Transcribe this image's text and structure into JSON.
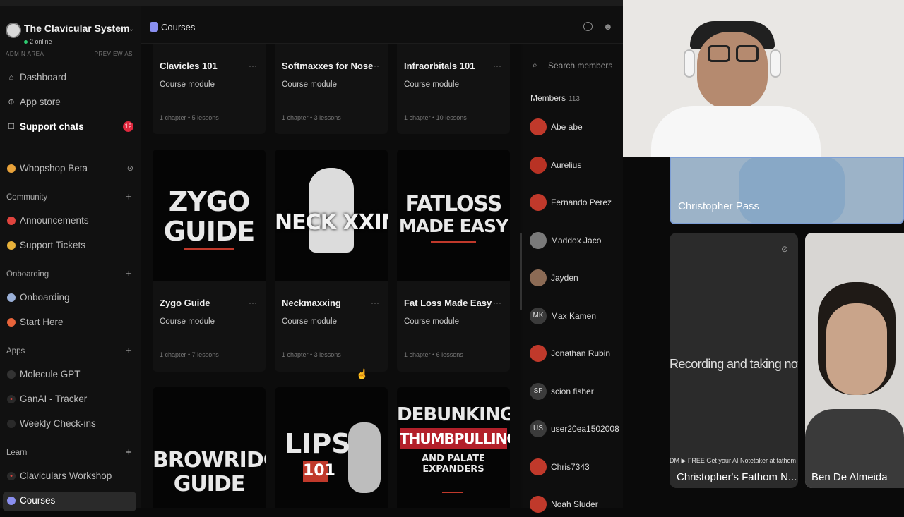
{
  "workspace": {
    "name": "The Clavicular System",
    "online": "2 online"
  },
  "admin": {
    "label": "ADMIN AREA",
    "preview": "PREVIEW AS"
  },
  "nav_top": [
    {
      "label": "Dashboard",
      "icon": "home-icon"
    },
    {
      "label": "App store",
      "icon": "plus-circle-icon"
    },
    {
      "label": "Support chats",
      "icon": "chat-icon",
      "badge": "12"
    }
  ],
  "whopshop": {
    "label": "Whopshop Beta"
  },
  "sections": {
    "community": {
      "label": "Community",
      "items": [
        "Announcements",
        "Support Tickets"
      ]
    },
    "onboarding": {
      "label": "Onboarding",
      "items": [
        "Onboarding",
        "Start Here"
      ]
    },
    "apps": {
      "label": "Apps",
      "items": [
        "Molecule GPT",
        "GanAI - Tracker",
        "Weekly Check-ins"
      ]
    },
    "learn": {
      "label": "Learn",
      "items": [
        "Claviculars Workshop",
        "Courses"
      ]
    }
  },
  "header": {
    "title": "Courses"
  },
  "courses": [
    {
      "title": "Clavicles 101",
      "type": "Course module",
      "meta": "1 chapter • 5 lessons"
    },
    {
      "title": "Softmaxxes for Nose",
      "type": "Course module",
      "meta": "1 chapter • 3 lessons"
    },
    {
      "title": "Infraorbitals 101",
      "type": "Course module",
      "meta": "1 chapter • 10 lessons"
    },
    {
      "title": "Zygo Guide",
      "type": "Course module",
      "meta": "1 chapter • 7 lessons",
      "art": [
        "ZYGO",
        "GUIDE"
      ]
    },
    {
      "title": "Neckmaxxing",
      "type": "Course module",
      "meta": "1 chapter • 3 lessons",
      "art": [
        "NECK",
        "XXING"
      ]
    },
    {
      "title": "Fat Loss Made Easy",
      "type": "Course module",
      "meta": "1 chapter • 6 lessons",
      "art": [
        "FATLOSS",
        "MADE EASY"
      ]
    },
    {
      "art": [
        "BROWRIDGE",
        "GUIDE"
      ]
    },
    {
      "art": [
        "LIPS",
        "101"
      ]
    },
    {
      "art": [
        "DEBUNKING",
        "THUMBPULLING",
        "AND PALATE EXPANDERS"
      ]
    }
  ],
  "members": {
    "search_placeholder": "Search members",
    "heading": "Members",
    "count": "113",
    "list": [
      {
        "name": "Abe abe",
        "initials": "",
        "color": "#c0392b"
      },
      {
        "name": "Aurelius",
        "initials": "",
        "color": "#b83224"
      },
      {
        "name": "Fernando Perez",
        "initials": "",
        "color": "#c0392b"
      },
      {
        "name": "Maddox Jaco",
        "initials": "",
        "color": "#7a7a7a"
      },
      {
        "name": "Jayden",
        "initials": "",
        "color": "#8c6b55"
      },
      {
        "name": "Max Kamen",
        "initials": "MK",
        "color": "#3b3b3b"
      },
      {
        "name": "Jonathan Rubin",
        "initials": "",
        "color": "#c0392b"
      },
      {
        "name": "scion fisher",
        "initials": "SF",
        "color": "#3b3b3b"
      },
      {
        "name": "user20ea1502008",
        "initials": "US",
        "color": "#3b3b3b"
      },
      {
        "name": "Chris7343",
        "initials": "",
        "color": "#c0392b"
      },
      {
        "name": "Noah Sluder",
        "initials": "",
        "color": "#c0392b"
      }
    ]
  },
  "call": {
    "tile1_name": "Christopher Pass",
    "tile2_name": "Christopher's Fathom N...",
    "tile2_status": "Recording and taking notes",
    "tile2_banner": "DM ▶ FREE  Get your AI Notetaker at fathom",
    "tile2_free": "FREE",
    "tile3_name": "Ben De Almeida"
  }
}
